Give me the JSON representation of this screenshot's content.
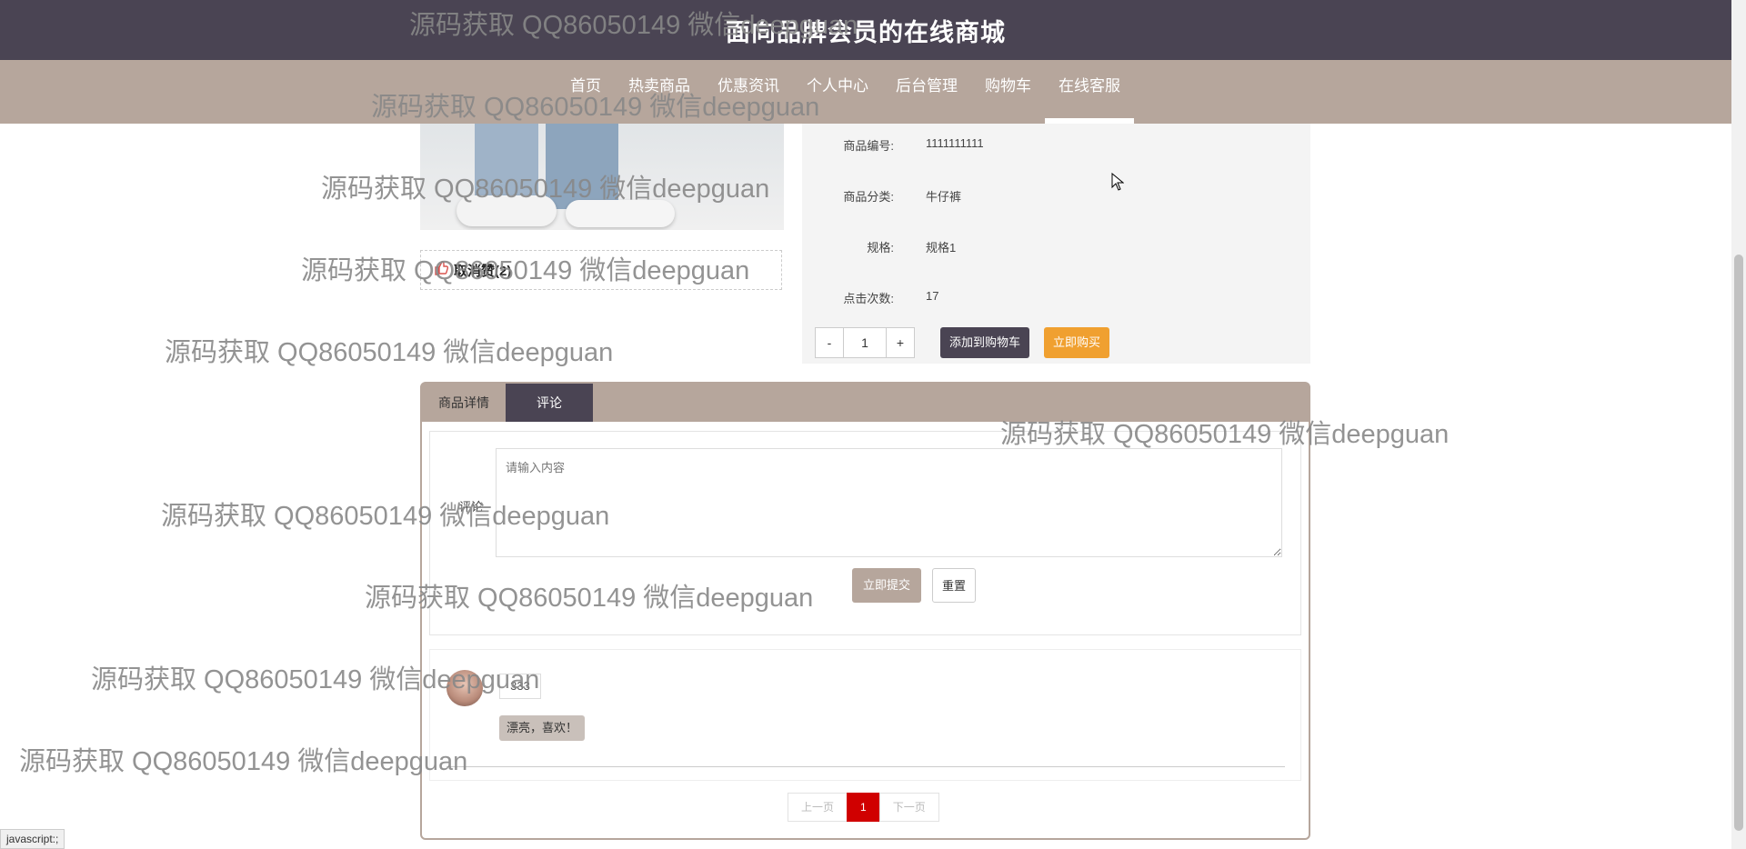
{
  "header": {
    "title": "面向品牌会员的在线商城"
  },
  "nav": {
    "items": [
      "首页",
      "热卖商品",
      "优惠资讯",
      "个人中心",
      "后台管理",
      "购物车",
      "在线客服"
    ]
  },
  "product": {
    "like_label": "取消赞(2)",
    "fields": [
      {
        "label": "商品编号:",
        "value": "1111111111"
      },
      {
        "label": "商品分类:",
        "value": "牛仔裤"
      },
      {
        "label": "规格:",
        "value": "规格1"
      },
      {
        "label": "点击次数:",
        "value": "17"
      }
    ],
    "quantity": "1",
    "minus": "-",
    "plus": "+",
    "add_to_cart": "添加到购物车",
    "buy_now": "立即购买"
  },
  "tabs": {
    "details": "商品详情",
    "comments": "评论"
  },
  "comment_form": {
    "label": "评论",
    "placeholder": "请输入内容",
    "submit": "立即提交",
    "reset": "重置"
  },
  "comments": [
    {
      "user": "333",
      "content": "漂亮，喜欢！"
    }
  ],
  "pagination": {
    "prev": "上一页",
    "current": "1",
    "next": "下一页"
  },
  "watermark": "源码获取 QQ86050149 微信deepguan",
  "status_bar": "javascript:;"
}
